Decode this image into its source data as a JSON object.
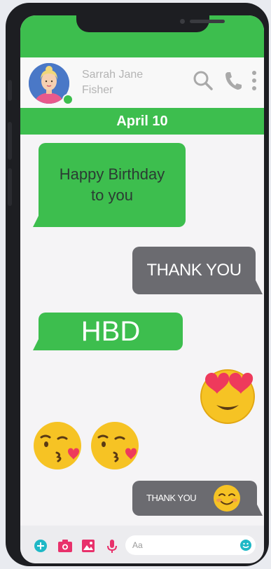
{
  "contact": {
    "name_line1": "Sarrah Jane",
    "name_line2": "Fisher",
    "status": "online"
  },
  "header_icons": [
    "search-icon",
    "phone-icon",
    "more-vert-icon"
  ],
  "date_label": "April 10",
  "messages": [
    {
      "direction": "incoming",
      "lines": [
        "Happy Birthday",
        "to you"
      ]
    },
    {
      "direction": "outgoing",
      "text": "THANK YOU"
    },
    {
      "direction": "incoming",
      "text": "HBD"
    },
    {
      "direction": "outgoing",
      "emoji": "heart-eyes-emoji"
    },
    {
      "direction": "incoming",
      "emoji": [
        "kissing-heart-emoji",
        "kissing-heart-emoji"
      ]
    },
    {
      "direction": "outgoing",
      "text": "THANK YOU",
      "emoji": "smiling-blush-emoji"
    }
  ],
  "composer": {
    "placeholder": "Aa",
    "icons": [
      "add-icon",
      "camera-icon",
      "image-icon",
      "mic-icon",
      "emoji-icon"
    ]
  },
  "colors": {
    "accent_green": "#3dbe4e",
    "outgoing_gray": "#6b6b70",
    "icon_pink": "#e8316b"
  }
}
